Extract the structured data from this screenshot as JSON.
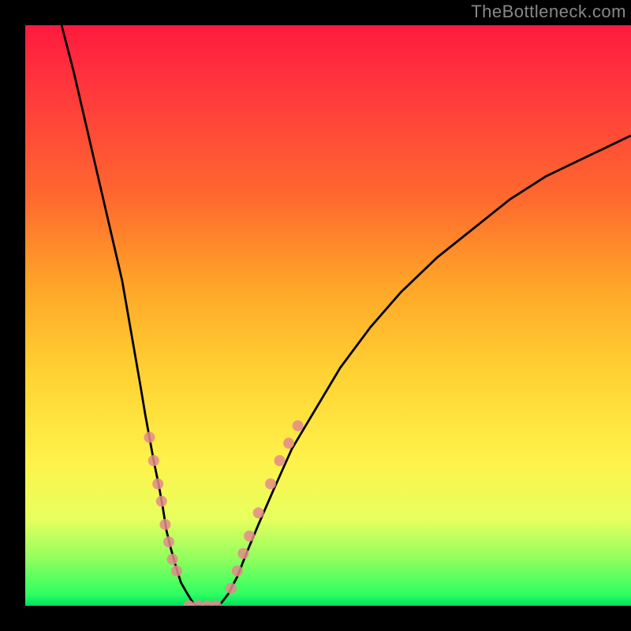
{
  "watermark": "TheBottleneck.com",
  "chart_data": {
    "type": "line",
    "title": "",
    "xlabel": "",
    "ylabel": "",
    "xlim": [
      0,
      100
    ],
    "ylim": [
      0,
      100
    ],
    "grid": false,
    "legend": false,
    "background_gradient": {
      "type": "vertical",
      "stops": [
        {
          "at": 0,
          "color": "#ff1a3f",
          "meaning": "bad/high bottleneck"
        },
        {
          "at": 50,
          "color": "#ffd233",
          "meaning": "medium"
        },
        {
          "at": 100,
          "color": "#00e060",
          "meaning": "good/no bottleneck"
        }
      ]
    },
    "series": [
      {
        "name": "left-curve",
        "x": [
          6,
          8,
          10,
          12,
          14,
          16,
          17,
          18,
          19,
          19.8,
          20.5,
          21.2,
          22.0,
          22.7,
          23.3,
          24.0,
          24.8,
          25.7,
          26.8,
          28.0
        ],
        "y": [
          100,
          92,
          83,
          74,
          65,
          56,
          50,
          44,
          38,
          33,
          29,
          25,
          21,
          17,
          13,
          10,
          7,
          4,
          2,
          0
        ]
      },
      {
        "name": "valley-floor",
        "x": [
          28.0,
          29.0,
          30.0,
          31.0,
          32.0
        ],
        "y": [
          0,
          0,
          0,
          0,
          0
        ]
      },
      {
        "name": "right-curve",
        "x": [
          32.0,
          33.5,
          35.0,
          36.5,
          38.5,
          41.0,
          44.0,
          48.0,
          52.0,
          57.0,
          62.0,
          68.0,
          74.0,
          80.0,
          86.0,
          92.0,
          98.0,
          100.0
        ],
        "y": [
          0,
          2,
          5,
          9,
          14,
          20,
          27,
          34,
          41,
          48,
          54,
          60,
          65,
          70,
          74,
          77,
          80,
          81
        ]
      }
    ],
    "markers": [
      {
        "series": "left-curve",
        "x": 20.5,
        "y": 29,
        "group": "left-cluster"
      },
      {
        "series": "left-curve",
        "x": 21.2,
        "y": 25,
        "group": "left-cluster"
      },
      {
        "series": "left-curve",
        "x": 21.9,
        "y": 21,
        "group": "left-cluster"
      },
      {
        "series": "left-curve",
        "x": 22.5,
        "y": 18,
        "group": "left-cluster"
      },
      {
        "series": "left-curve",
        "x": 23.1,
        "y": 14,
        "group": "left-cluster"
      },
      {
        "series": "left-curve",
        "x": 23.7,
        "y": 11,
        "group": "left-cluster"
      },
      {
        "series": "left-curve",
        "x": 24.3,
        "y": 8,
        "group": "left-cluster"
      },
      {
        "series": "left-curve",
        "x": 25.0,
        "y": 6,
        "group": "left-cluster"
      },
      {
        "series": "valley-floor",
        "x": 27.0,
        "y": 0,
        "group": "bottom-cluster"
      },
      {
        "series": "valley-floor",
        "x": 28.5,
        "y": 0,
        "group": "bottom-cluster"
      },
      {
        "series": "valley-floor",
        "x": 30.0,
        "y": 0,
        "group": "bottom-cluster"
      },
      {
        "series": "valley-floor",
        "x": 31.5,
        "y": 0,
        "group": "bottom-cluster"
      },
      {
        "series": "right-curve",
        "x": 34.0,
        "y": 3,
        "group": "right-cluster"
      },
      {
        "series": "right-curve",
        "x": 35.0,
        "y": 6,
        "group": "right-cluster"
      },
      {
        "series": "right-curve",
        "x": 36.0,
        "y": 9,
        "group": "right-cluster"
      },
      {
        "series": "right-curve",
        "x": 37.0,
        "y": 12,
        "group": "right-cluster"
      },
      {
        "series": "right-curve",
        "x": 38.5,
        "y": 16,
        "group": "right-cluster"
      },
      {
        "series": "right-curve",
        "x": 40.5,
        "y": 21,
        "group": "right-cluster"
      },
      {
        "series": "right-curve",
        "x": 42.0,
        "y": 25,
        "group": "right-cluster"
      },
      {
        "series": "right-curve",
        "x": 43.5,
        "y": 28,
        "group": "right-cluster"
      },
      {
        "series": "right-curve",
        "x": 45.0,
        "y": 31,
        "group": "right-cluster"
      }
    ],
    "marker_style": {
      "shape": "circle",
      "radius": 7,
      "fill": "#e38b8b",
      "opacity": 0.85
    },
    "line_style": {
      "stroke": "#000000",
      "width": 2.8
    }
  }
}
